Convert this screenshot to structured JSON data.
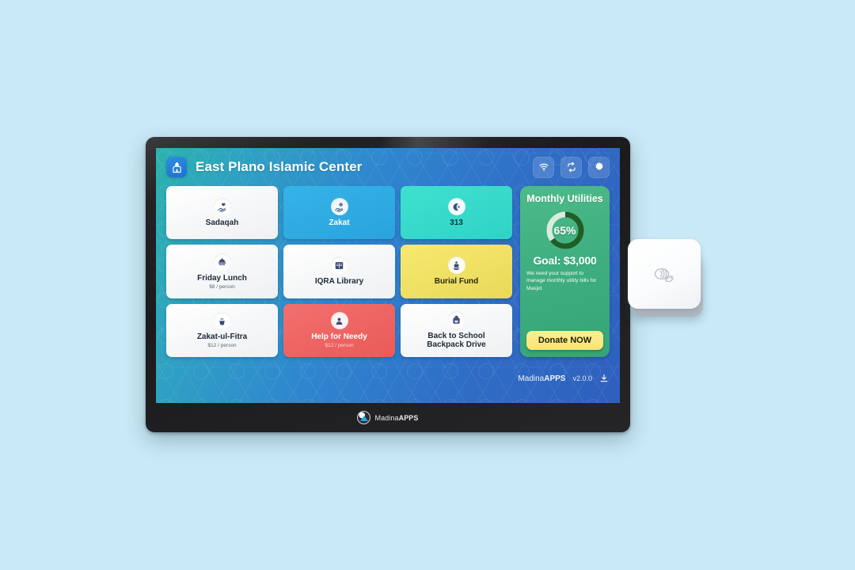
{
  "device": {
    "bezel_brand": "Madina",
    "bezel_brand_bold": "APPS"
  },
  "header": {
    "org_logo_icon": "mosque-icon",
    "title": "East Plano Islamic Center",
    "actions": [
      {
        "name": "wifi-icon",
        "label": "Wi-Fi"
      },
      {
        "name": "sync-icon",
        "label": "Sync"
      },
      {
        "name": "gear-icon",
        "label": "Settings"
      }
    ]
  },
  "tiles": [
    {
      "label": "Sadaqah",
      "sub": "",
      "style": "t-white",
      "icon": "hand-heart-icon"
    },
    {
      "label": "Zakat",
      "sub": "",
      "style": "t-blue",
      "icon": "hand-coin-icon"
    },
    {
      "label": "313",
      "sub": "",
      "style": "t-teal",
      "icon": "crescent-star-icon"
    },
    {
      "label": "Friday Lunch",
      "sub": "$8 / person",
      "style": "t-white",
      "icon": "food-tray-icon"
    },
    {
      "label": "IQRA Library",
      "sub": "",
      "style": "t-white",
      "icon": "book-icon"
    },
    {
      "label": "Burial Fund",
      "sub": "",
      "style": "t-yellow",
      "icon": "person-pray-icon"
    },
    {
      "label": "Zakat-ul-Fitra",
      "sub": "$12 / person",
      "style": "t-white",
      "icon": "grain-scoop-icon"
    },
    {
      "label": "Help for Needy",
      "sub": "$12 / person",
      "style": "t-red",
      "icon": "person-icon"
    },
    {
      "label": "Back to School\nBackpack Drive",
      "sub": "",
      "style": "t-white",
      "icon": "backpack-icon"
    }
  ],
  "campaign": {
    "title": "Monthly Utilities",
    "progress_percent": 65,
    "progress_label": "65%",
    "goal": "Goal: $3,000",
    "description": "We need your support to manage monthly utility bills for Masjid.",
    "donate_label": "Donate NOW",
    "ring_color": "#1f5e24",
    "ring_track_color": "#d8ece0",
    "panel_color": "#41b183",
    "button_color": "#f8e473"
  },
  "footer": {
    "brand": "Madina",
    "brand_bold": "APPS",
    "version": "v2.0.0",
    "download_icon": "download-icon"
  },
  "card_reader": {
    "icon": "contactless-tap-icon"
  }
}
